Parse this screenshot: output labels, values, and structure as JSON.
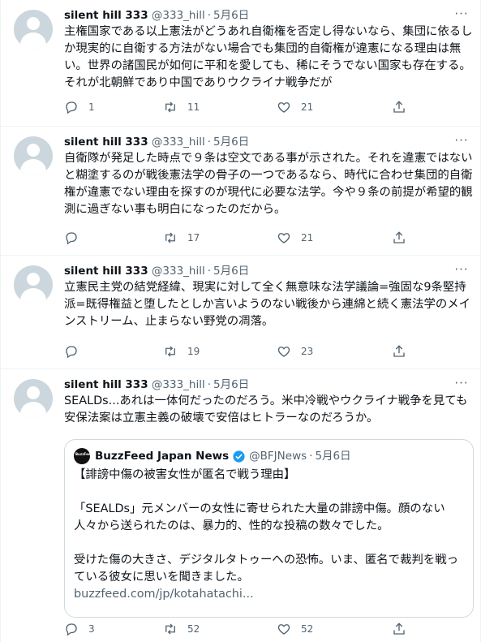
{
  "tweets": [
    {
      "name": "silent hill 333",
      "handle": "@333_hill",
      "date": "5月6日",
      "text": "主権国家である以上憲法がどうあれ自衛権を否定し得ないなら、集団に依るしか現実的に自衛する方法がない場合でも集団的自衛権が違憲になる理由は無い。世界の諸国民が如何に平和を愛しても、稀にそうでない国家も存在する。それが北朝鮮であり中国でありウクライナ戦争だが",
      "replies": "1",
      "retweets": "11",
      "likes": "21"
    },
    {
      "name": "silent hill 333",
      "handle": "@333_hill",
      "date": "5月6日",
      "text": "自衛隊が発足した時点で９条は空文である事が示された。それを違憲ではないと糊塗するのが戦後憲法学の骨子の一つであるなら、時代に合わせ集団的自衛権が違憲でない理由を探すのが現代に必要な法学。今や９条の前提が希望的観測に過ぎない事も明白になったのだから。",
      "replies": "",
      "retweets": "17",
      "likes": "21"
    },
    {
      "name": "silent hill 333",
      "handle": "@333_hill",
      "date": "5月6日",
      "text": "立憲民主党の結党経緯、現実に対して全く無意味な法学議論=強固な9条堅持派=既得権益と堕したとしか言いようのない戦後から連綿と続く憲法学のメインストリーム、止まらない野党の凋落。",
      "replies": "",
      "retweets": "19",
      "likes": "23"
    },
    {
      "name": "silent hill 333",
      "handle": "@333_hill",
      "date": "5月6日",
      "text": "SEALDs...あれは一体何だったのだろう。米中冷戦やウクライナ戦争を見ても安保法案は立憲主義の破壊で安倍はヒトラーなのだろうか。",
      "replies": "3",
      "retweets": "52",
      "likes": "52",
      "quote": {
        "avatar_text": "BuzzFeed",
        "name": "BuzzFeed Japan News",
        "handle": "@BFJNews",
        "date": "5月6日",
        "line1": "【誹謗中傷の被害女性が匿名で戦う理由】",
        "line2": "「SEALDs」元メンバーの女性に寄せられた大量の誹謗中傷。顔のない人々から送られたのは、暴力的、性的な投稿の数々でした。",
        "line3": "受けた傷の大きさ、デジタルタトゥーへの恐怖。いま、匿名で裁判を戦っている彼女に思いを聞きました。",
        "link": "buzzfeed.com/jp/kotahatachi..."
      }
    }
  ],
  "header_separator": "·",
  "more_glyph": "···",
  "colors": {
    "text": "#0f1419",
    "secondary": "#536471",
    "verified": "#1d9bf0",
    "border": "#eff3f4"
  },
  "icons": [
    "reply-icon",
    "retweet-icon",
    "like-icon",
    "share-icon",
    "more-icon",
    "verified-icon"
  ]
}
